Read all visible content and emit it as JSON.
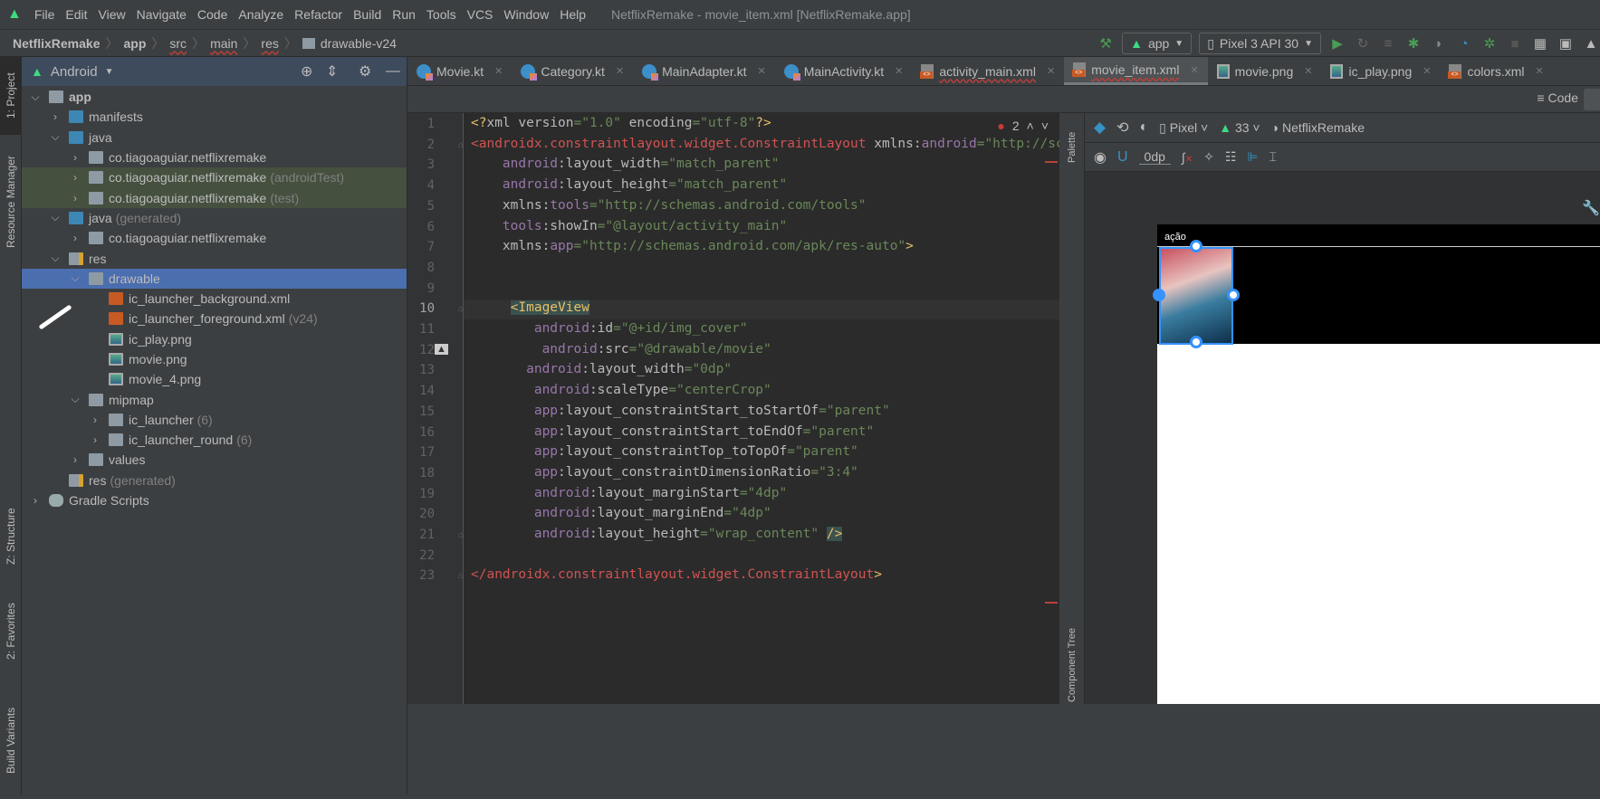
{
  "menu": [
    "File",
    "Edit",
    "View",
    "Navigate",
    "Code",
    "Analyze",
    "Refactor",
    "Build",
    "Run",
    "Tools",
    "VCS",
    "Window",
    "Help"
  ],
  "window_title": "NetflixRemake - movie_item.xml [NetflixRemake.app]",
  "breadcrumb": [
    "NetflixRemake",
    "app",
    "src",
    "main",
    "res",
    "drawable-v24"
  ],
  "run": {
    "config": "app",
    "device": "Pixel 3 API 30"
  },
  "side_tabs": {
    "project": "1: Project",
    "resource_manager": "Resource Manager",
    "structure": "Z: Structure",
    "favorites": "2: Favorites",
    "variants": "Build Variants"
  },
  "project": {
    "view": "Android",
    "tree": [
      {
        "level": 0,
        "arrow": "down",
        "icon": "module",
        "label": "app",
        "bold": true
      },
      {
        "level": 1,
        "arrow": "right",
        "icon": "folder-blue",
        "label": "manifests"
      },
      {
        "level": 1,
        "arrow": "down",
        "icon": "folder-blue",
        "label": "java"
      },
      {
        "level": 2,
        "arrow": "right",
        "icon": "package",
        "label": "co.tiagoaguiar.netflixremake"
      },
      {
        "level": 2,
        "arrow": "right",
        "icon": "package",
        "label": "co.tiagoaguiar.netflixremake",
        "suffix": "(androidTest)",
        "hl": true
      },
      {
        "level": 2,
        "arrow": "right",
        "icon": "package",
        "label": "co.tiagoaguiar.netflixremake",
        "suffix": "(test)",
        "hl": true
      },
      {
        "level": 1,
        "arrow": "down",
        "icon": "folder-gen",
        "label": "java",
        "suffix": "(generated)"
      },
      {
        "level": 2,
        "arrow": "right",
        "icon": "package",
        "label": "co.tiagoaguiar.netflixremake"
      },
      {
        "level": 1,
        "arrow": "down",
        "icon": "folder-res",
        "label": "res"
      },
      {
        "level": 2,
        "arrow": "down",
        "icon": "package",
        "label": "drawable",
        "sel": true
      },
      {
        "level": 3,
        "arrow": "",
        "icon": "xml",
        "label": "ic_launcher_background.xml"
      },
      {
        "level": 3,
        "arrow": "",
        "icon": "xml",
        "label": "ic_launcher_foreground.xml",
        "suffix": "(v24)"
      },
      {
        "level": 3,
        "arrow": "",
        "icon": "png",
        "label": "ic_play.png"
      },
      {
        "level": 3,
        "arrow": "",
        "icon": "png",
        "label": "movie.png"
      },
      {
        "level": 3,
        "arrow": "",
        "icon": "png",
        "label": "movie_4.png"
      },
      {
        "level": 2,
        "arrow": "down",
        "icon": "package",
        "label": "mipmap"
      },
      {
        "level": 3,
        "arrow": "right",
        "icon": "package",
        "label": "ic_launcher",
        "suffix": "(6)"
      },
      {
        "level": 3,
        "arrow": "right",
        "icon": "package",
        "label": "ic_launcher_round",
        "suffix": "(6)"
      },
      {
        "level": 2,
        "arrow": "right",
        "icon": "package",
        "label": "values"
      },
      {
        "level": 1,
        "arrow": "",
        "icon": "folder-res",
        "label": "res",
        "suffix": "(generated)"
      },
      {
        "level": 0,
        "arrow": "right",
        "icon": "gradle",
        "label": "Gradle Scripts"
      }
    ]
  },
  "tabs": [
    {
      "label": "Movie.kt",
      "icon": "kotlin"
    },
    {
      "label": "Category.kt",
      "icon": "kotlin"
    },
    {
      "label": "MainAdapter.kt",
      "icon": "kotlin"
    },
    {
      "label": "MainActivity.kt",
      "icon": "kotlin"
    },
    {
      "label": "activity_main.xml",
      "icon": "xml",
      "err": true
    },
    {
      "label": "movie_item.xml",
      "icon": "xml",
      "err": true,
      "active": true
    },
    {
      "label": "movie.png",
      "icon": "png"
    },
    {
      "label": "ic_play.png",
      "icon": "png"
    },
    {
      "label": "colors.xml",
      "icon": "xml"
    }
  ],
  "view_mode": {
    "code": "Code"
  },
  "editor": {
    "error_count": "2",
    "current_line": 10,
    "lines": [
      [
        [
          "pi",
          "<?"
        ],
        [
          "attr",
          "xml "
        ],
        [
          "attr",
          "version"
        ],
        [
          "val",
          "=\"1.0\" "
        ],
        [
          "attr",
          "encoding"
        ],
        [
          "val",
          "=\"utf-8\""
        ],
        [
          "pi",
          "?>"
        ]
      ],
      [
        [
          "err",
          "<androidx.constraintlayout.widget.ConstraintLayout "
        ],
        [
          "attr",
          "xmlns:"
        ],
        [
          "ns",
          "android"
        ],
        [
          "val",
          "=\"http://schemas.android.com/apk/res/android\""
        ]
      ],
      [
        [
          "plain",
          "    "
        ],
        [
          "ns",
          "android"
        ],
        [
          "attr",
          ":layout_width"
        ],
        [
          "val",
          "=\"match_parent\""
        ]
      ],
      [
        [
          "plain",
          "    "
        ],
        [
          "ns",
          "android"
        ],
        [
          "attr",
          ":layout_height"
        ],
        [
          "val",
          "=\"match_parent\""
        ]
      ],
      [
        [
          "plain",
          "    "
        ],
        [
          "attr",
          "xmlns:"
        ],
        [
          "ns",
          "tools"
        ],
        [
          "val",
          "=\"http://schemas.android.com/tools\""
        ]
      ],
      [
        [
          "plain",
          "    "
        ],
        [
          "ns",
          "tools"
        ],
        [
          "attr",
          ":showIn"
        ],
        [
          "val",
          "=\"@layout/activity_main\""
        ]
      ],
      [
        [
          "plain",
          "    "
        ],
        [
          "attr",
          "xmlns:"
        ],
        [
          "ns",
          "app"
        ],
        [
          "val",
          "=\"http://schemas.android.com/apk/res-auto\""
        ],
        [
          "pi",
          ">"
        ]
      ],
      [],
      [],
      [
        [
          "plain",
          "     "
        ],
        [
          "tag-hl",
          "<ImageView"
        ]
      ],
      [
        [
          "plain",
          "        "
        ],
        [
          "ns",
          "android"
        ],
        [
          "attr",
          ":id"
        ],
        [
          "val",
          "=\"@+id/img_cover\""
        ]
      ],
      [
        [
          "plain",
          "         "
        ],
        [
          "ns",
          "android"
        ],
        [
          "attr",
          ":src"
        ],
        [
          "val",
          "=\"@drawable/movie\""
        ]
      ],
      [
        [
          "plain",
          "       "
        ],
        [
          "ns",
          "android"
        ],
        [
          "attr",
          ":layout_width"
        ],
        [
          "val",
          "=\"0dp\""
        ]
      ],
      [
        [
          "plain",
          "        "
        ],
        [
          "ns",
          "android"
        ],
        [
          "attr",
          ":scaleType"
        ],
        [
          "val",
          "=\"centerCrop\""
        ]
      ],
      [
        [
          "plain",
          "        "
        ],
        [
          "ns",
          "app"
        ],
        [
          "attr",
          ":layout_constraintStart_toStartOf"
        ],
        [
          "val",
          "=\"parent\""
        ]
      ],
      [
        [
          "plain",
          "        "
        ],
        [
          "ns",
          "app"
        ],
        [
          "attr",
          ":layout_constraintStart_toEndOf"
        ],
        [
          "val",
          "=\"parent\""
        ]
      ],
      [
        [
          "plain",
          "        "
        ],
        [
          "ns",
          "app"
        ],
        [
          "attr",
          ":layout_constraintTop_toTopOf"
        ],
        [
          "val",
          "=\"parent\""
        ]
      ],
      [
        [
          "plain",
          "        "
        ],
        [
          "ns",
          "app"
        ],
        [
          "attr",
          ":layout_constraintDimensionRatio"
        ],
        [
          "val",
          "=\"3:4\""
        ]
      ],
      [
        [
          "plain",
          "        "
        ],
        [
          "ns",
          "android"
        ],
        [
          "attr",
          ":layout_marginStart"
        ],
        [
          "val",
          "=\"4dp\""
        ]
      ],
      [
        [
          "plain",
          "        "
        ],
        [
          "ns",
          "android"
        ],
        [
          "attr",
          ":layout_marginEnd"
        ],
        [
          "val",
          "=\"4dp\""
        ]
      ],
      [
        [
          "plain",
          "        "
        ],
        [
          "ns",
          "android"
        ],
        [
          "attr",
          ":layout_height"
        ],
        [
          "val",
          "=\"wrap_content\" "
        ],
        [
          "tag-hl",
          "/>"
        ]
      ],
      [],
      [
        [
          "err",
          "</androidx.constraintlayout.widget.ConstraintLayout"
        ],
        [
          "pi",
          ">"
        ]
      ]
    ]
  },
  "design": {
    "palette": "Palette",
    "component_tree": "Component Tree",
    "device": "Pixel",
    "api": "33",
    "theme": "NetflixRemake",
    "margin": "0dp",
    "preview_title": "ação"
  }
}
